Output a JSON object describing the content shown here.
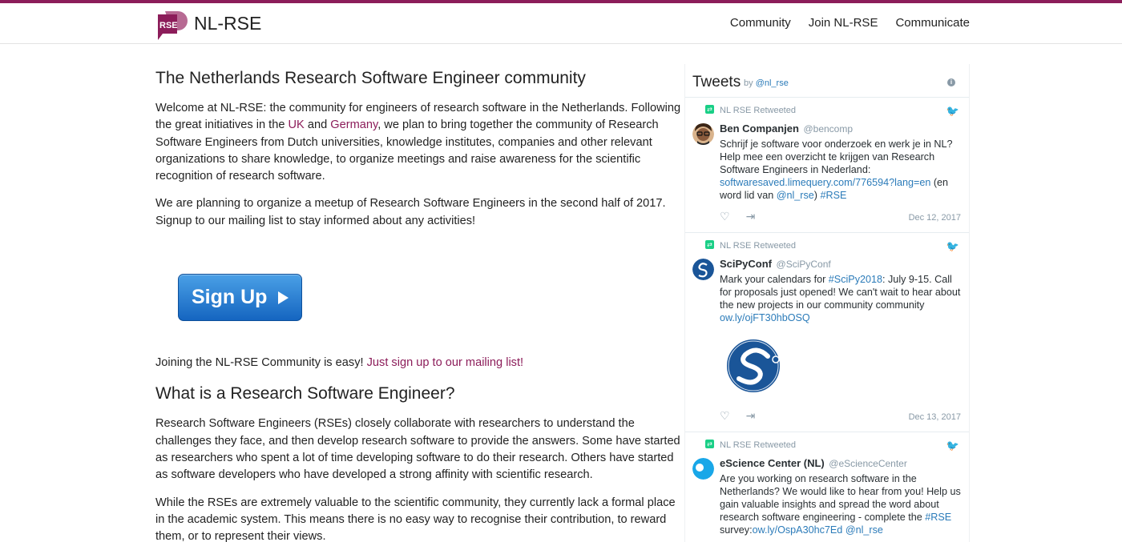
{
  "brand": {
    "name": "NL-RSE",
    "logo_text": "RSE"
  },
  "nav": {
    "items": [
      "Community",
      "Join NL-RSE",
      "Communicate"
    ]
  },
  "main": {
    "title": "The Netherlands Research Software Engineer community",
    "intro": {
      "part1": "Welcome at NL-RSE: the community for engineers of research software in the Netherlands. Following the great initiatives in the ",
      "link_uk": "UK",
      "part2": " and ",
      "link_germany": "Germany",
      "part3": ", we plan to bring together the community of Research Software Engineers from Dutch universities, knowledge institutes, companies and other relevant organizations to share knowledge, to organize meetings and raise awareness for the scientific recognition of research software."
    },
    "meetup": "We are planning to organize a meetup of Research Software Engineers in the second half of 2017. Signup to our mailing list to stay informed about any activities!",
    "signup_button": "Sign Up",
    "joining": {
      "text": "Joining the NL-RSE Community is easy! ",
      "link": "Just sign up to our mailing list!"
    },
    "what_heading": "What is a Research Software Engineer?",
    "what_p1": "Research Software Engineers (RSEs) closely collaborate with researchers to understand the challenges they face, and then develop research software to provide the answers. Some have started as researchers who spent a lot of time developing software to do their research. Others have started as software developers who have developed a strong affinity with scientific research.",
    "what_p2": "While the RSEs are extremely valuable to the scientific community, they currently lack a formal place in the academic system. This means there is no easy way to recognise their contribution, to reward them, or to represent their views."
  },
  "tweets": {
    "title": "Tweets",
    "by": "by ",
    "by_handle": "@nl_rse",
    "items": [
      {
        "retweet_label": "NL RSE Retweeted",
        "name": "Ben Companjen",
        "handle": "@bencomp",
        "text1": "Schrijf je software voor onderzoek en werk je in NL? Help mee een overzicht te krijgen van Research Software Engineers in Nederland: ",
        "link1": "softwaresaved.limequery.com/776594?lang=en",
        "text2": " (en word lid van ",
        "link2": "@nl_rse",
        "text3": ") ",
        "link3": "#RSE",
        "date": "Dec 12, 2017"
      },
      {
        "retweet_label": "NL RSE Retweeted",
        "name": "SciPyConf",
        "handle": "@SciPyConf",
        "text1": "Mark your calendars for ",
        "link1": "#SciPy2018",
        "text2": ": July 9-15. Call for proposals just opened! We can't wait to hear about the new projects in our community community ",
        "link2": "ow.ly/ojFT30hbOSQ",
        "date": "Dec 13, 2017"
      },
      {
        "retweet_label": "NL RSE Retweeted",
        "name": "eScience Center (NL)",
        "handle": "@eScienceCenter",
        "text1": "Are you working on research software in the Netherlands? We would like to hear from you! Help us gain valuable insights and spread the word about research software engineering - complete the ",
        "link1": "#RSE",
        "text2": " survey:",
        "link2": "ow.ly/OspA30hc7Ed",
        "text3": " ",
        "link3": "@nl_rse"
      }
    ]
  },
  "colors": {
    "brand": "#8c1d5a",
    "link_twitter": "#2b7bb9",
    "button": "#1e7ad6"
  },
  "icons": [
    "rse-logo-icon",
    "info-icon",
    "retweet-icon",
    "twitter-bird-icon",
    "like-heart-icon",
    "share-icon",
    "scipy-logo-icon"
  ]
}
